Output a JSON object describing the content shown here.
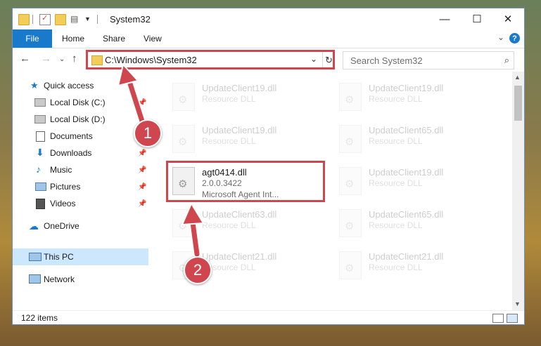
{
  "window": {
    "title": "System32",
    "controls": {
      "minimize": "—",
      "maximize": "☐",
      "close": "✕"
    }
  },
  "ribbon": {
    "tabs": [
      {
        "label": "File"
      },
      {
        "label": "Home"
      },
      {
        "label": "Share"
      },
      {
        "label": "View"
      }
    ],
    "help": "?"
  },
  "navigation": {
    "address": "C:\\Windows\\System32",
    "search_placeholder": "Search System32"
  },
  "sidebar": {
    "items": [
      {
        "label": "Quick access"
      },
      {
        "label": "Local Disk (C:)"
      },
      {
        "label": "Local Disk (D:)"
      },
      {
        "label": "Documents"
      },
      {
        "label": "Downloads"
      },
      {
        "label": "Music"
      },
      {
        "label": "Pictures"
      },
      {
        "label": "Videos"
      },
      {
        "label": "OneDrive"
      },
      {
        "label": "This PC"
      },
      {
        "label": "Network"
      }
    ]
  },
  "files": {
    "col1": [
      {
        "name": "UpdateClient19.dll",
        "type": "Resource DLL"
      },
      {
        "name": "UpdateClient19.dll",
        "type": "Resource DLL"
      },
      {
        "name": "agt0414.dll",
        "version": "2.0.0.3422",
        "type": "Microsoft Agent Int..."
      },
      {
        "name": "UpdateClient63.dll",
        "type": "Resource DLL"
      },
      {
        "name": "UpdateClient21.dll",
        "type": "Resource DLL"
      }
    ],
    "col2": [
      {
        "name": "UpdateClient19.dll",
        "type": "Resource DLL"
      },
      {
        "name": "UpdateClient65.dll",
        "type": "Resource DLL"
      },
      {
        "name": "UpdateClient19.dll",
        "type": "Resource DLL"
      },
      {
        "name": "UpdateClient65.dll",
        "type": "Resource DLL"
      },
      {
        "name": "UpdateClient21.dll",
        "type": "Resource DLL"
      }
    ]
  },
  "status": {
    "item_count": "122 items"
  },
  "annotations": {
    "step1": "1",
    "step2": "2"
  },
  "colors": {
    "accent": "#1979ca",
    "highlight": "#d0464f",
    "selected": "#cce8ff"
  }
}
